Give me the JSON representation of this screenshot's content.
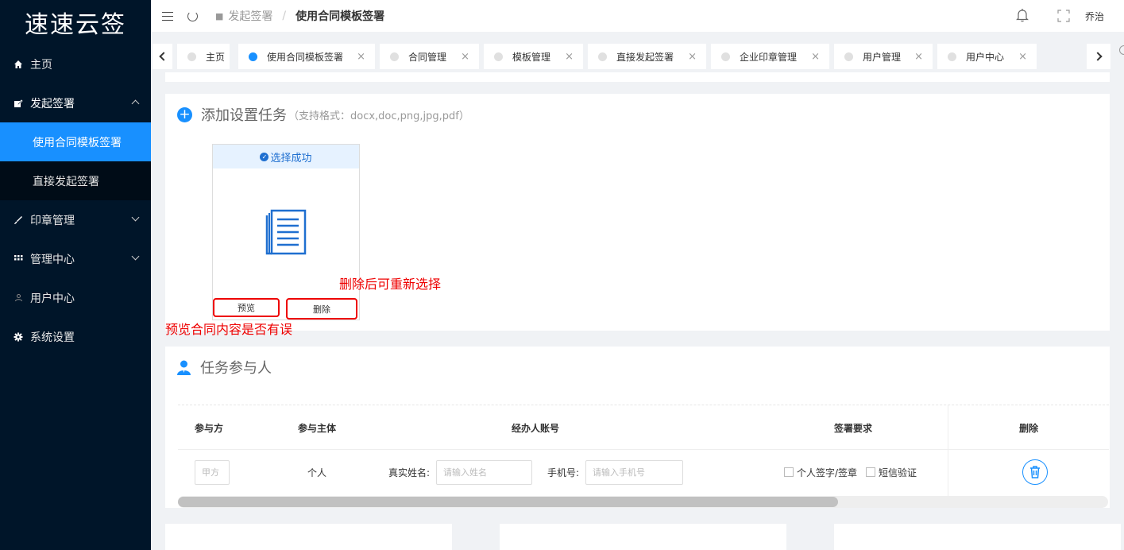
{
  "app": {
    "logo": "速速云签"
  },
  "sidebar": {
    "items": [
      {
        "label": "主页"
      },
      {
        "label": "发起签署"
      },
      {
        "label": "印章管理"
      },
      {
        "label": "管理中心"
      },
      {
        "label": "用户中心"
      },
      {
        "label": "系统设置"
      }
    ],
    "sub_sign": [
      {
        "label": "使用合同模板签署",
        "active": true
      },
      {
        "label": "直接发起签署"
      }
    ]
  },
  "header": {
    "breadcrumb": [
      "发起签署",
      "使用合同模板签署"
    ],
    "separator": "/",
    "user": "乔治"
  },
  "tabs": [
    {
      "label": "主页"
    },
    {
      "label": "使用合同模板签署",
      "active": true
    },
    {
      "label": "合同管理"
    },
    {
      "label": "模板管理"
    },
    {
      "label": "直接发起签署"
    },
    {
      "label": "企业印章管理"
    },
    {
      "label": "用户管理"
    },
    {
      "label": "用户中心"
    }
  ],
  "tab_close": "×",
  "task": {
    "title": "添加设置任务",
    "formats": "（支持格式：docx,doc,png,jpg,pdf）",
    "status": "选择成功",
    "preview_label": "预览",
    "delete_label": "删除",
    "note_delete": "删除后可重新选择",
    "note_preview": "预览合同内容是否有误"
  },
  "participants": {
    "title": "任务参与人",
    "columns": [
      "参与方",
      "参与主体",
      "经办人账号",
      "签署要求",
      "删除"
    ],
    "row": {
      "party": "甲方",
      "subject": "个人",
      "name_label": "真实姓名:",
      "name_placeholder": "请输入姓名",
      "phone_label": "手机号:",
      "phone_placeholder": "请输入手机号",
      "req1": "个人签字/签章",
      "req2": "短信验证"
    }
  },
  "colors": {
    "sidebar_bg": "#001529",
    "accent": "#1890ff",
    "annotation": "#e00000"
  }
}
